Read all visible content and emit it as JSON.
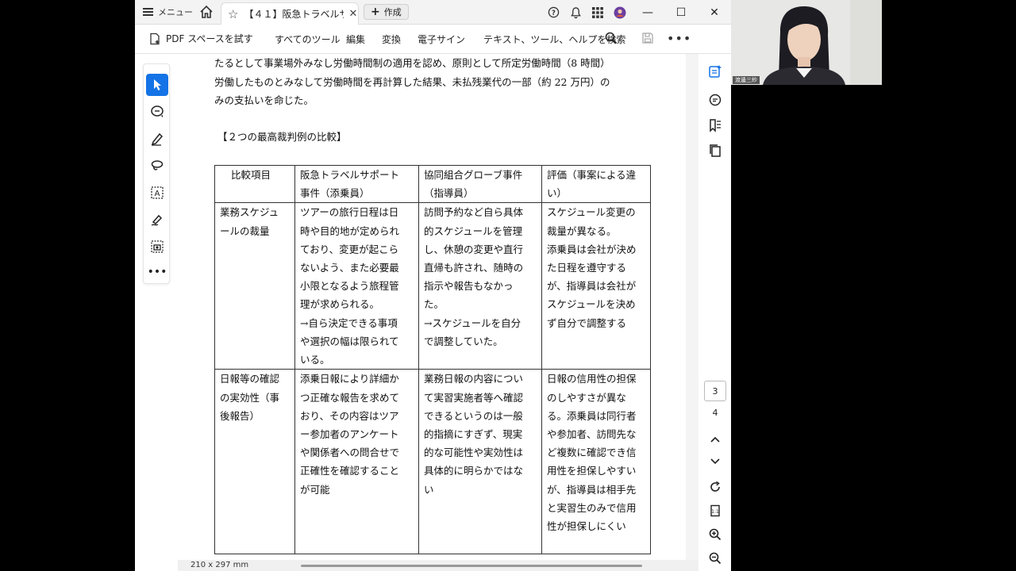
{
  "titlebar": {
    "menu_label": "メニュー",
    "tab_title": "【４１】阪急トラベルサ...",
    "create_label": "作成",
    "help_icon": "help-icon",
    "bell_icon": "bell-icon",
    "apps_icon": "apps-grid-icon"
  },
  "toolbar": {
    "pdf_spaces": "PDF スペースを試す",
    "all_tools": "すべてのツール",
    "edit": "編集",
    "convert": "変換",
    "esign": "電子サイン",
    "search_hint": "テキスト、ツール、ヘルプを検索"
  },
  "document": {
    "para_lines": [
      "たるとして事業場外みなし労働時間制の適用を認め、原則として所定労働時間（8 時間）",
      "労働したものとみなして労働時間を再計算した結果、未払残業代の一部（約 22 万円）の",
      "みの支払いを命じた。"
    ],
    "heading": "【２つの最高裁判例の比較】",
    "table": {
      "headers": [
        [
          "比較項目"
        ],
        [
          "阪急トラベルサポート",
          "事件（添乗員）"
        ],
        [
          "協同組合グローブ事件",
          "（指導員）"
        ],
        [
          "評価（事案による違",
          "い）"
        ]
      ],
      "rows": [
        [
          [
            "業務スケジュ",
            "ールの裁量"
          ],
          [
            "ツアーの旅行日程は日",
            "時や目的地が定められ",
            "ており、変更が起こら",
            "ないよう、また必要最",
            "小限となるよう旅程管",
            "理が求められる。",
            "→自ら決定できる事項",
            "や選択の幅は限られて",
            "いる。"
          ],
          [
            "訪問予約など自ら具体",
            "的スケジュールを管理",
            "し、休憩の変更や直行",
            "直帰も許され、随時の",
            "指示や報告もなかっ",
            "た。",
            "→スケジュールを自分",
            "で調整していた。"
          ],
          [
            "スケジュール変更の",
            "裁量が異なる。",
            "添乗員は会社が決め",
            "た日程を遵守する",
            "が、指導員は会社が",
            "スケジュールを決め",
            "ず自分で調整する"
          ]
        ],
        [
          [
            "日報等の確認",
            "の実効性（事",
            "後報告）"
          ],
          [
            "添乗日報により詳細か",
            "つ正確な報告を求めて",
            "おり、その内容はツア",
            "ー参加者のアンケート",
            "や関係者への問合せで",
            "正確性を確認すること",
            "が可能"
          ],
          [
            "業務日報の内容につい",
            "て実習実施者等へ確認",
            "できるというのは一般",
            "的指摘にすぎず、現実",
            "的な可能性や実効性は",
            "具体的に明らかではな",
            "い"
          ],
          [
            "日報の信用性の担保",
            "のしやすさが異な",
            "る。添乗員は同行者",
            "や参加者、訪問先な",
            "ど複数に確認でき信",
            "用性を担保しやすい",
            "が、指導員は相手先",
            "と実習生のみで信用",
            "性が担保しにくい"
          ]
        ]
      ]
    }
  },
  "navigation": {
    "current_page": "3",
    "next_page": "4"
  },
  "statusbar": {
    "page_size": "210 x 297 mm"
  },
  "webcam": {
    "name_label": "渡邊三紗"
  },
  "colors": {
    "accent": "#1473e6",
    "table_border": "#333333"
  }
}
